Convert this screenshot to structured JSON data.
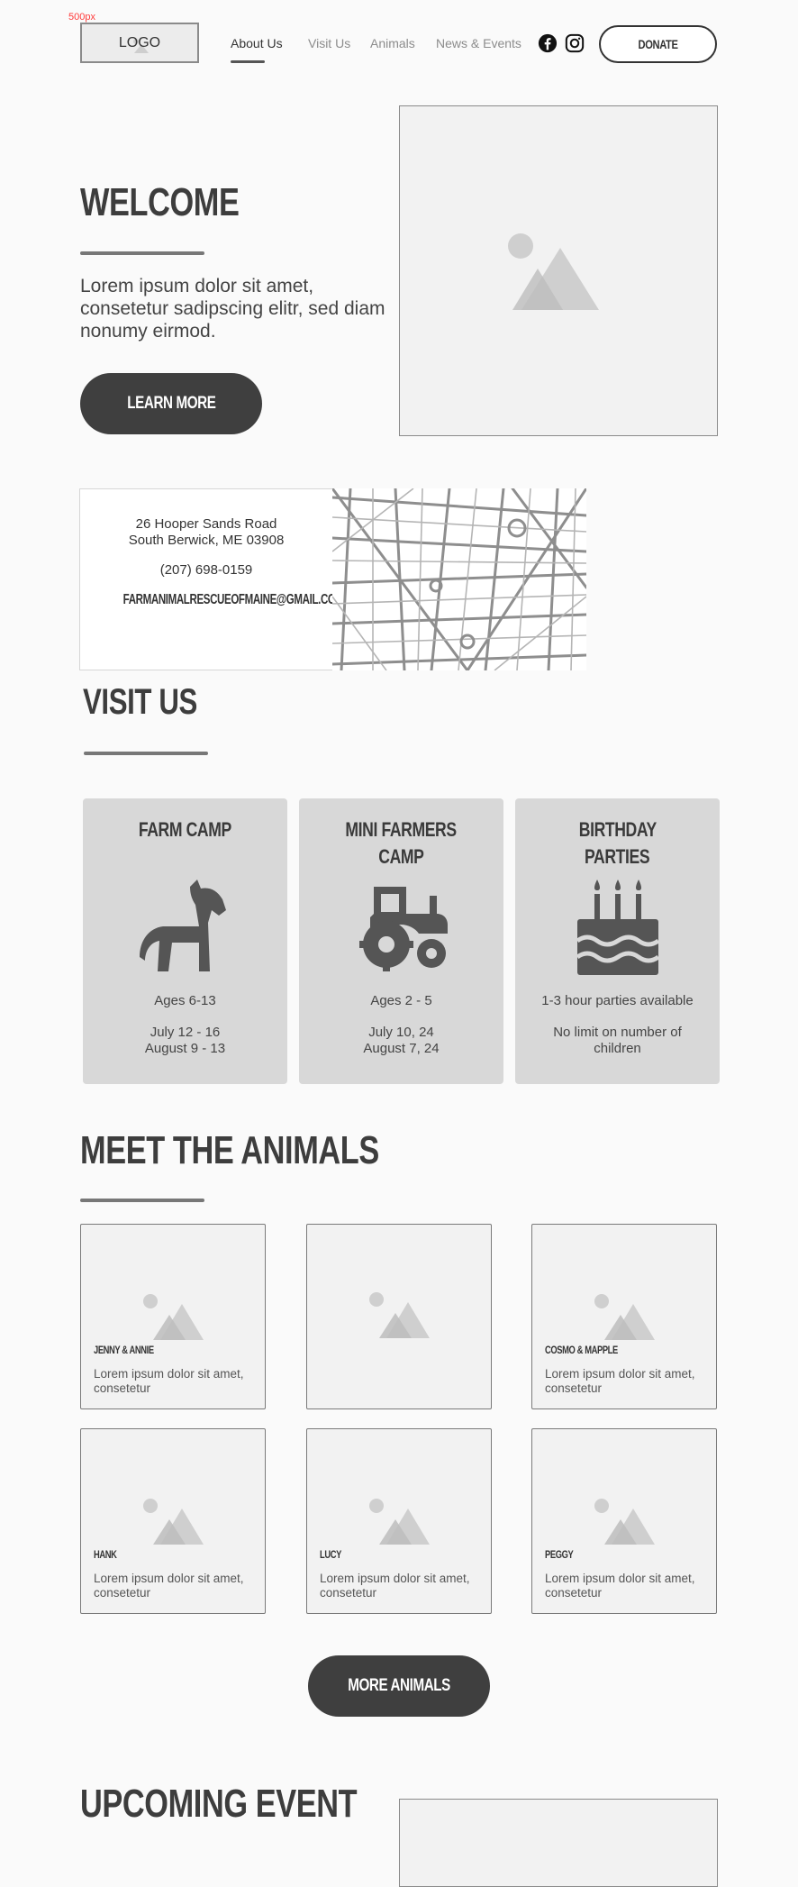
{
  "annotation": "500px",
  "header": {
    "logo": "LOGO",
    "nav": [
      {
        "label": "About Us",
        "active": true
      },
      {
        "label": "Visit Us",
        "active": false
      },
      {
        "label": "Animals",
        "active": false
      },
      {
        "label": "News & Events",
        "active": false
      }
    ],
    "social_icons": [
      "facebook-icon",
      "instagram-icon"
    ],
    "donate": "DONATE"
  },
  "hero": {
    "title": "WELCOME",
    "text": "Lorem ipsum dolor sit amet, consetetur sadipscing elitr, sed diam nonumy eirmod.",
    "button": "LEARN MORE"
  },
  "contact": {
    "address_line1": "26 Hooper Sands Road",
    "address_line2": "South Berwick, ME 03908",
    "phone": "(207) 698-0159",
    "email": "FARMANIMALRESCUEOFMAINE@GMAIL.COM"
  },
  "visit": {
    "title": "VISIT US",
    "cards": [
      {
        "title1": "FARM CAMP",
        "title2": "",
        "icon": "horse-icon",
        "line1": "Ages 6-13",
        "line2": "July 12 - 16",
        "line3": "August 9 - 13"
      },
      {
        "title1": "MINI FARMERS",
        "title2": "CAMP",
        "icon": "tractor-icon",
        "line1": "Ages 2 - 5",
        "line2": "July 10, 24",
        "line3": "August 7, 24"
      },
      {
        "title1": "BIRTHDAY",
        "title2": "PARTIES",
        "icon": "birthday-cake-icon",
        "line1": "1-3 hour parties available",
        "line2": "No limit on number of",
        "line3": "children"
      }
    ]
  },
  "animals": {
    "title": "MEET THE ANIMALS",
    "tiles": [
      {
        "name": "JENNY & ANNIE",
        "desc": "Lorem ipsum dolor sit amet, consetetur"
      },
      {
        "name": "",
        "desc": ""
      },
      {
        "name": "COSMO & MAPPLE",
        "desc": "Lorem ipsum dolor sit amet, consetetur"
      },
      {
        "name": "HANK",
        "desc": "Lorem ipsum dolor sit amet, consetetur"
      },
      {
        "name": "LUCY",
        "desc": "Lorem ipsum dolor sit amet, consetetur"
      },
      {
        "name": "PEGGY",
        "desc": "Lorem ipsum dolor sit amet, consetetur"
      }
    ],
    "button": "MORE ANIMALS"
  },
  "event": {
    "title": "UPCOMING EVENT"
  },
  "colors": {
    "background": "#fafafa",
    "dark_button": "#3f3f3f",
    "card": "#d8d8d8",
    "placeholder": "#f2f2f2",
    "annotation": "#ff3b3b"
  }
}
